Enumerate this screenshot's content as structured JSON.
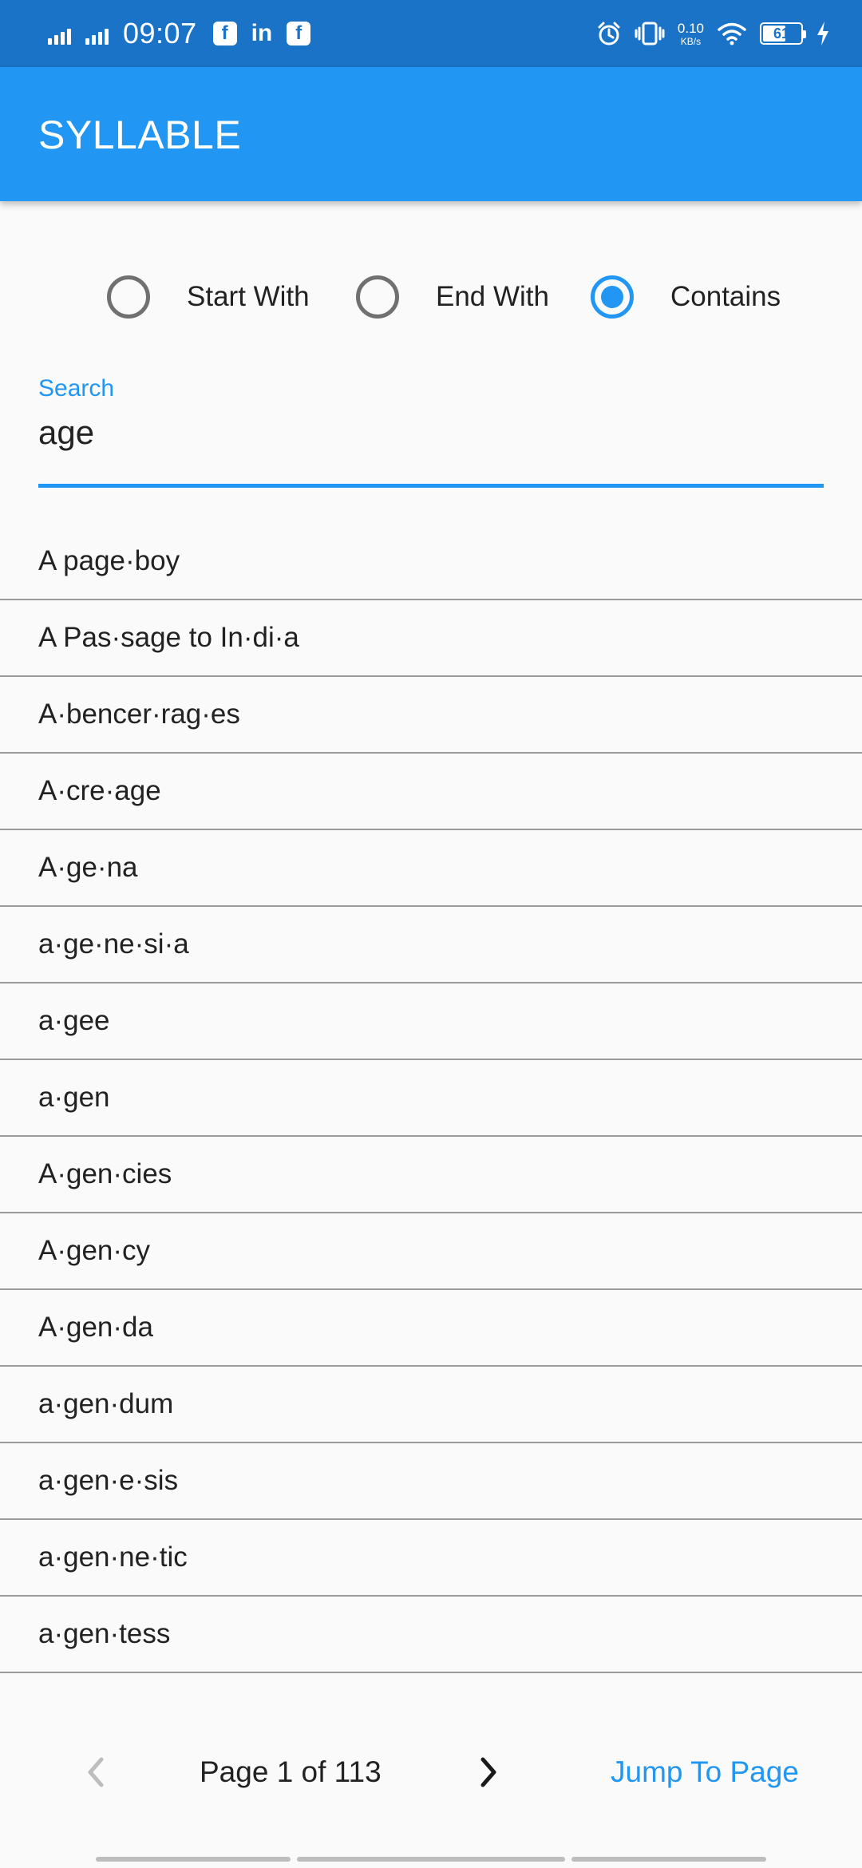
{
  "status_bar": {
    "time": "09:07",
    "network_speed": "0.10",
    "network_unit": "KB/s",
    "battery": "61",
    "battery_fraction": 0.61,
    "icons": [
      "signal-icon",
      "signal-icon",
      "facebook-icon",
      "linkedin-icon",
      "facebook-icon",
      "alarm-icon",
      "vibrate-icon",
      "wifi-icon",
      "battery-icon",
      "charging-icon"
    ],
    "linkedin_text": "in",
    "facebook_text": "f"
  },
  "app_bar": {
    "title": "SYLLABLE",
    "color": "#2196f3"
  },
  "filter": {
    "options": [
      {
        "label": "Start With",
        "selected": false
      },
      {
        "label": "End With",
        "selected": false
      },
      {
        "label": "Contains",
        "selected": true
      }
    ]
  },
  "search": {
    "label": "Search",
    "value": "age"
  },
  "results": [
    "A page·boy",
    "A Pas·sage to In·di·a",
    "A·bencer·rag·es",
    "A·cre·age",
    "A·ge·na",
    "a·ge·ne·si·a",
    "a·gee",
    "a·gen",
    "A·gen·cies",
    "A·gen·cy",
    "A·gen·da",
    "a·gen·dum",
    "a·gen·e·sis",
    "a·gen·ne·tic",
    "a·gen·tess"
  ],
  "pagination": {
    "page_info": "Page 1 of 113",
    "jump_label": "Jump To Page",
    "prev_icon": "chevron-left-icon",
    "next_icon": "chevron-right-icon",
    "prev_enabled": false
  }
}
